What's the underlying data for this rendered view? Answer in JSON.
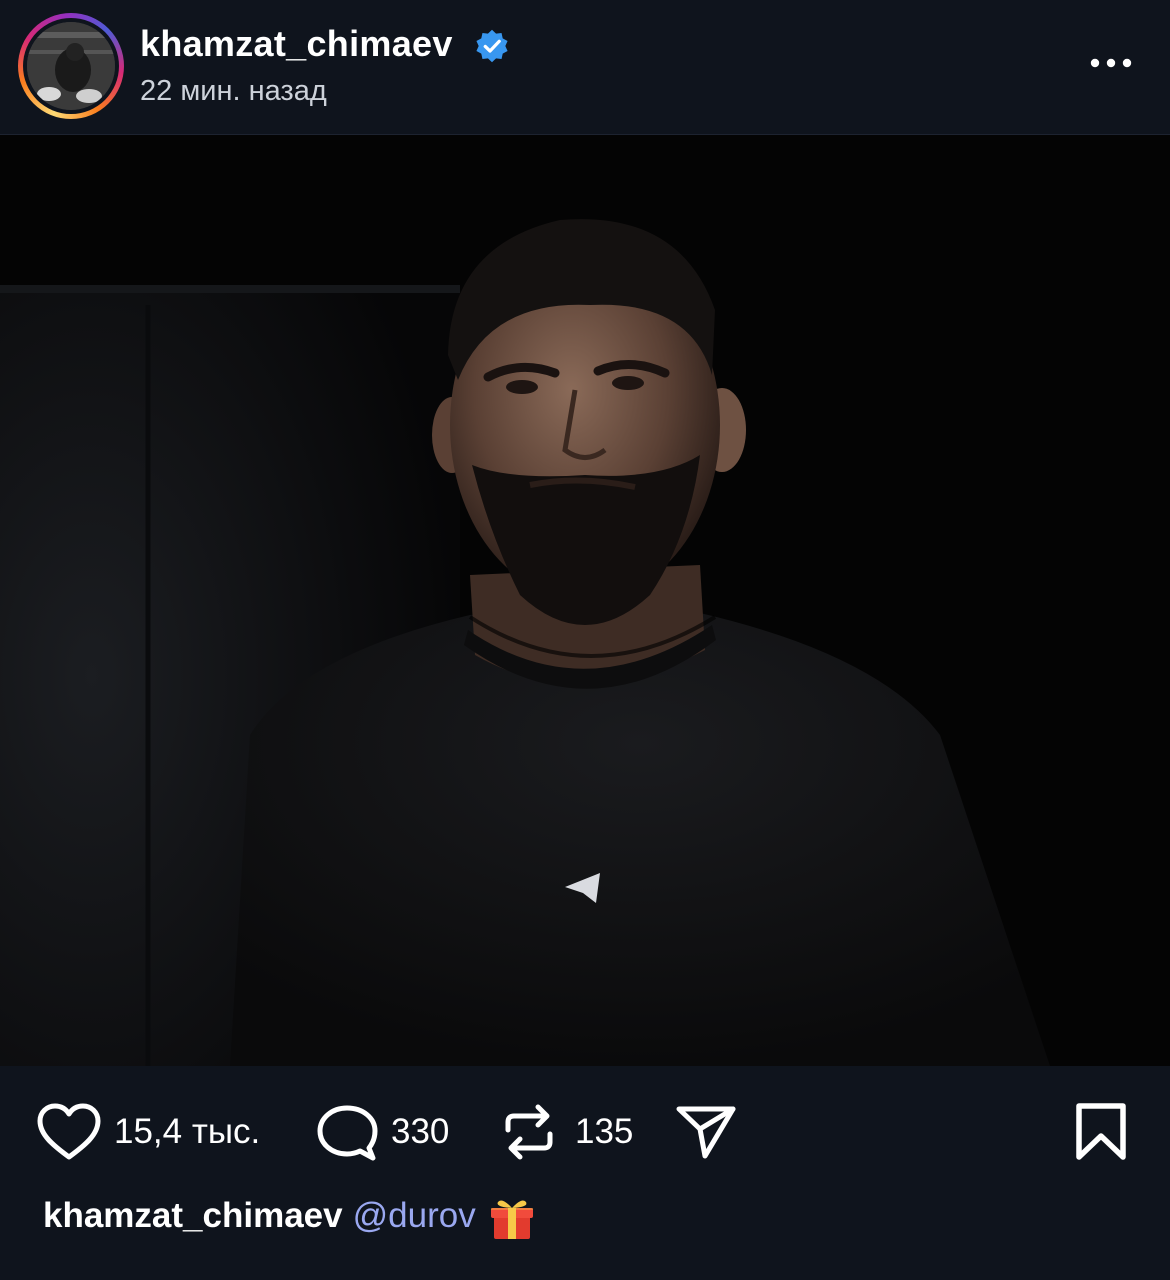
{
  "header": {
    "username": "khamzat_chimaev",
    "time_ago": "22 мин. назад"
  },
  "actions": {
    "likes": "15,4 тыс.",
    "comments": "330",
    "reposts": "135"
  },
  "caption": {
    "username": "khamzat_chimaev",
    "mention": "@durov"
  },
  "colors": {
    "background": "#0f141d",
    "verified": "#3897f0",
    "mention": "#9aa8f0"
  },
  "icons": [
    "verified-badge-icon",
    "more-icon",
    "heart-icon",
    "comment-icon",
    "repost-icon",
    "share-icon",
    "bookmark-icon",
    "gift-icon",
    "telegram-logo-icon"
  ]
}
